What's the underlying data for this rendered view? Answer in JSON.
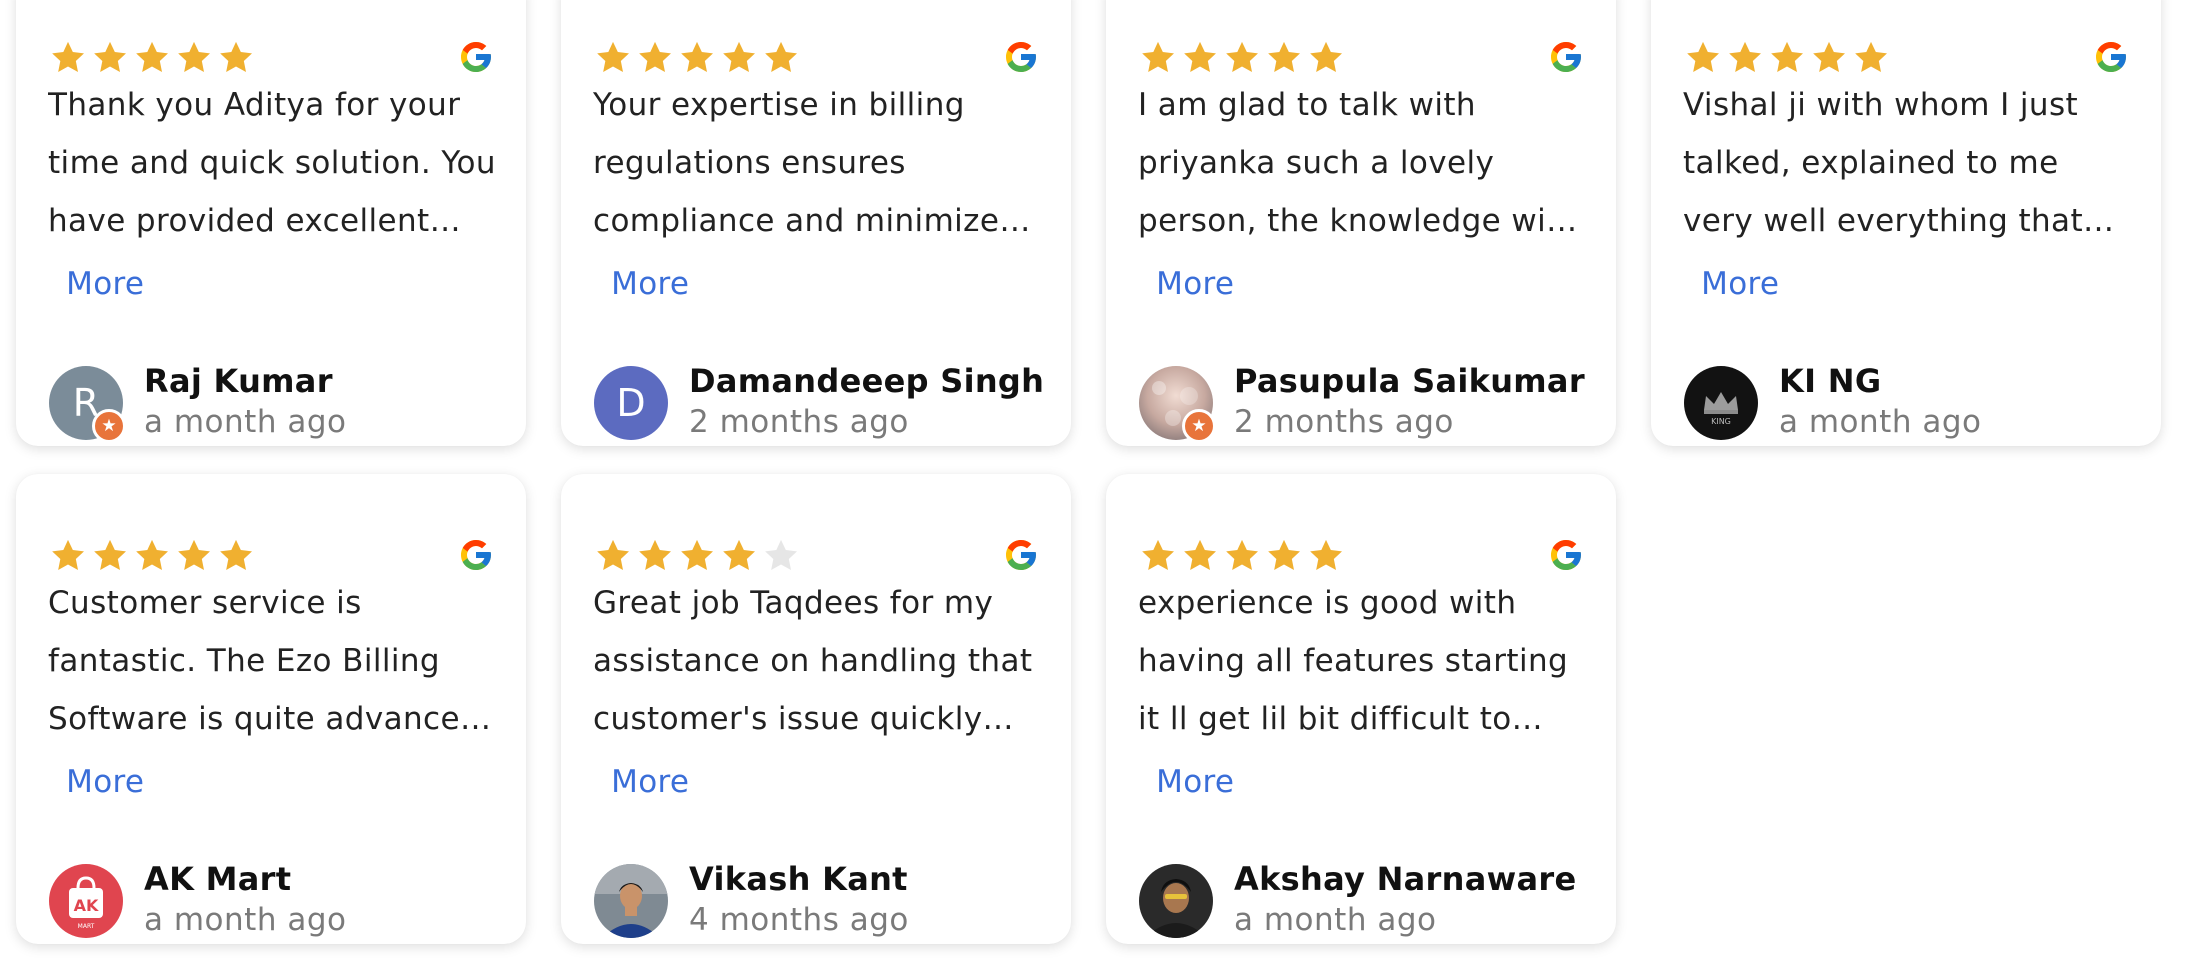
{
  "more_label": "More",
  "colors": {
    "star_filled": "#f0b030",
    "star_empty": "#e6e6e6",
    "more_link": "#3a6ed8",
    "badge": "#e8743b"
  },
  "reviews": [
    {
      "rating": 5,
      "text": "Thank you Aditya for your time and quick solution. You have provided excellent and very prompt service.",
      "author": "Raj Kumar",
      "date": "a month ago",
      "avatar": {
        "type": "letter",
        "letter": "R",
        "bg": "#7b8c99",
        "badge": true
      }
    },
    {
      "rating": 5,
      "text": "Your expertise in billing regulations ensures compliance and minimizes errors in every invoice.",
      "author": "Damandeeep Singh",
      "date": "2 months ago",
      "avatar": {
        "type": "letter",
        "letter": "D",
        "bg": "#5c6bc0",
        "badge": false
      }
    },
    {
      "rating": 5,
      "text": "I am glad to talk with priyanka such a lovely person, the knowledge with which she explained everything.",
      "author": "Pasupula Saikumar",
      "date": "2 months ago",
      "avatar": {
        "type": "photo",
        "photo": "bokeh",
        "badge": true
      }
    },
    {
      "rating": 5,
      "text": "Vishal ji  with whom I just talked, explained to me very well everything that was needed for my business.",
      "author": "KI NG",
      "date": "a month ago",
      "avatar": {
        "type": "photo",
        "photo": "king",
        "badge": false
      }
    },
    {
      "rating": 5,
      "text": "Customer service is fantastic. The Ezo Billing Software is quite advanced and easy to use for daily work.",
      "author": "AK Mart",
      "date": "a month ago",
      "avatar": {
        "type": "photo",
        "photo": "akmart",
        "badge": false
      }
    },
    {
      "rating": 4,
      "text": "Great job Taqdees for my assistance on handling that customer's issue quickly and with patience.",
      "author": "Vikash Kant",
      "date": "4 months ago",
      "avatar": {
        "type": "photo",
        "photo": "person-blue",
        "badge": false
      }
    },
    {
      "rating": 5,
      "text": "experience  is good with having all features  starting it ll get lil bit difficult to understand but later it is easy.",
      "author": "Akshay Narnaware",
      "date": "a month ago",
      "avatar": {
        "type": "photo",
        "photo": "person-dark",
        "badge": false
      }
    }
  ]
}
